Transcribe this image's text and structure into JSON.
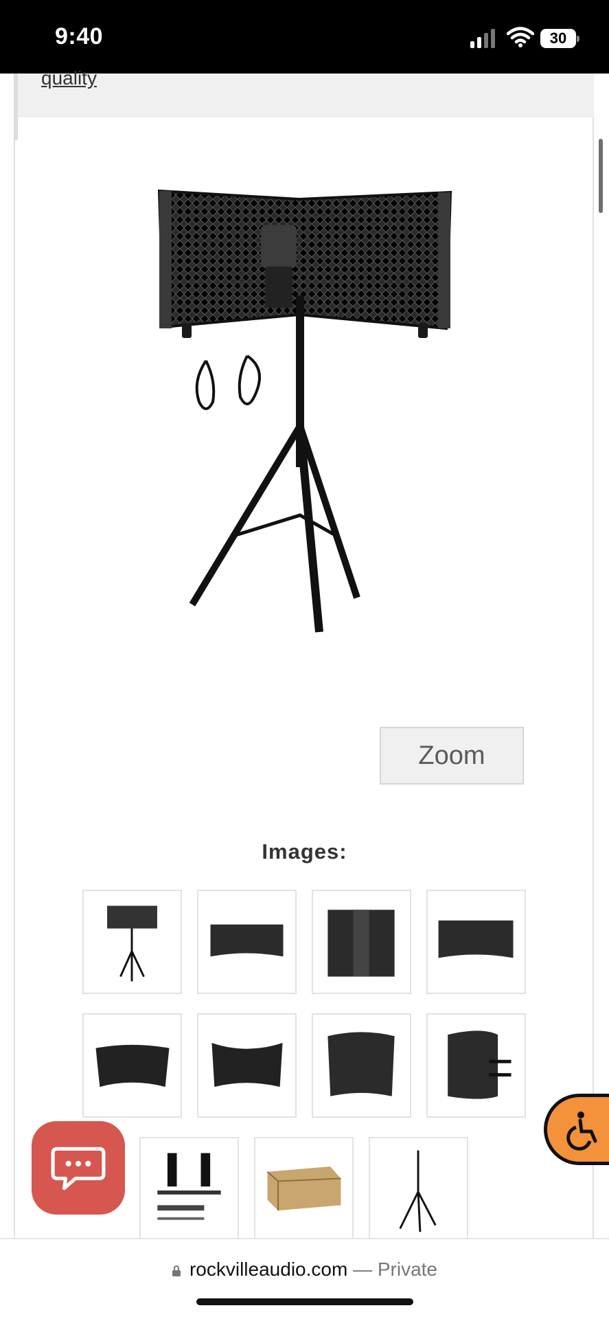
{
  "status_bar": {
    "time": "9:40",
    "battery": "30"
  },
  "page": {
    "quality_link": "quality",
    "zoom_label": "Zoom",
    "images_heading": "Images:"
  },
  "thumbnails": [
    {
      "name": "thumb-shield-mic-tripod"
    },
    {
      "name": "thumb-shield-front-wide"
    },
    {
      "name": "thumb-shield-folded-tall"
    },
    {
      "name": "thumb-shield-curved-front"
    },
    {
      "name": "thumb-shield-curved-angle"
    },
    {
      "name": "thumb-shield-concave"
    },
    {
      "name": "thumb-shield-side-panels"
    },
    {
      "name": "thumb-shield-cylinder-mounts"
    },
    {
      "name": "thumb-mount-brackets"
    },
    {
      "name": "thumb-product-box"
    },
    {
      "name": "thumb-tripod-stand"
    }
  ],
  "address_bar": {
    "domain": "rockvilleaudio.com",
    "separator": " — ",
    "private_label": "Private"
  },
  "colors": {
    "chat_button": "#d6574f",
    "accessibility_button": "#f4923b"
  },
  "icons": {
    "chat": "chat-bubble-icon",
    "accessibility": "wheelchair-icon",
    "lock": "lock-icon"
  }
}
